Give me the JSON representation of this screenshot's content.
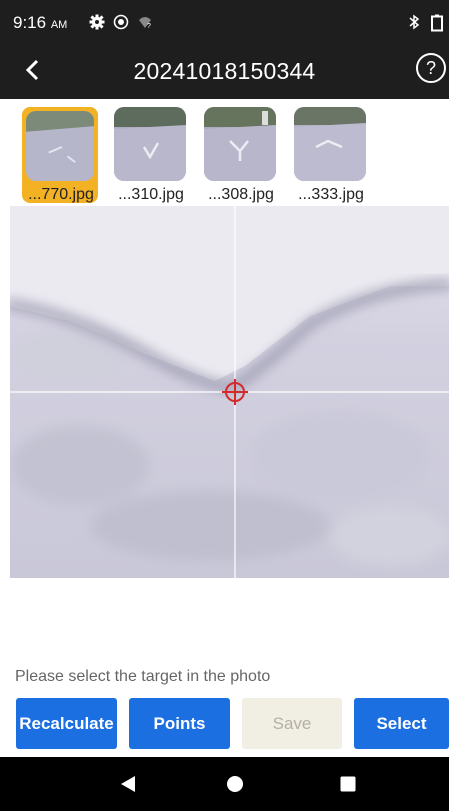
{
  "status": {
    "time": "9:16",
    "ampm": "AM",
    "icons": [
      "settings-icon",
      "record-icon",
      "wifi-off-icon",
      "bluetooth-icon",
      "battery-icon"
    ]
  },
  "header": {
    "title": "20241018150344",
    "back_icon": "chevron-left-icon",
    "help_label": "?"
  },
  "thumbnails": [
    {
      "caption": "...770.jpg",
      "selected": true
    },
    {
      "caption": "...310.jpg",
      "selected": false
    },
    {
      "caption": "...308.jpg",
      "selected": false
    },
    {
      "caption": "...333.jpg",
      "selected": false
    }
  ],
  "photo": {
    "crosshair_icon": "target-icon"
  },
  "prompt": "Please select the target in the photo",
  "buttons": {
    "recalculate": "Recalculate",
    "points": "Points",
    "save": "Save",
    "select": "Select"
  },
  "colors": {
    "accent": "#1c6fe0",
    "selected_thumb": "#f3b124",
    "bar": "#1e1e1e",
    "crosshair": "#d42a2a"
  },
  "navigation": {
    "icons": [
      "back-triangle-icon",
      "home-circle-icon",
      "recents-square-icon"
    ]
  }
}
